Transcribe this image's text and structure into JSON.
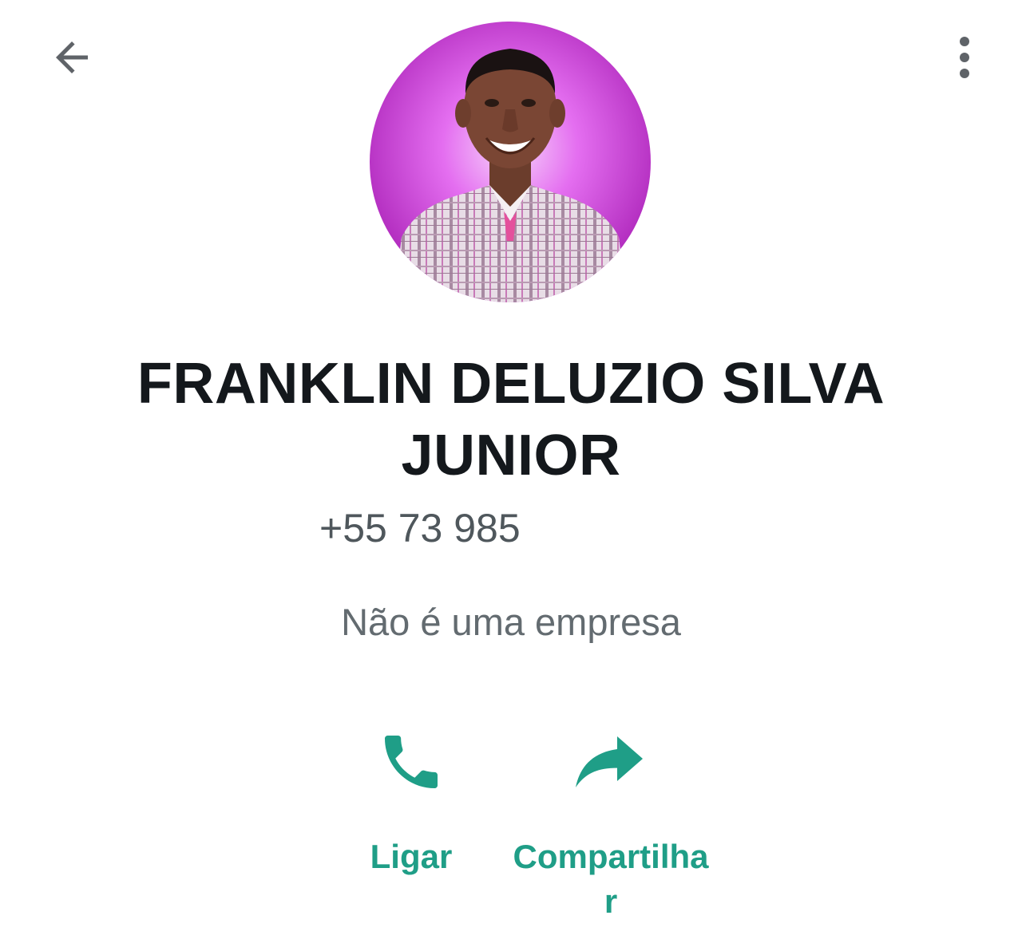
{
  "header": {
    "back_icon": "arrow-left-icon",
    "menu_icon": "more-vert-icon"
  },
  "profile": {
    "avatar": "profile-photo",
    "name": "FRANKLIN DELUZIO SILVA JUNIOR",
    "phone": "+55 73 985",
    "business_status": "Não é uma empresa"
  },
  "actions": [
    {
      "label": "Ligar",
      "icon": "phone-icon"
    },
    {
      "label": "Compartilhar",
      "icon": "share-arrow-icon"
    }
  ],
  "colors": {
    "accent": "#1f9e87",
    "text_primary": "#14181c",
    "text_secondary": "#636b70",
    "icon_gray": "#5f6368",
    "avatar_bg": "#c63ad4"
  }
}
